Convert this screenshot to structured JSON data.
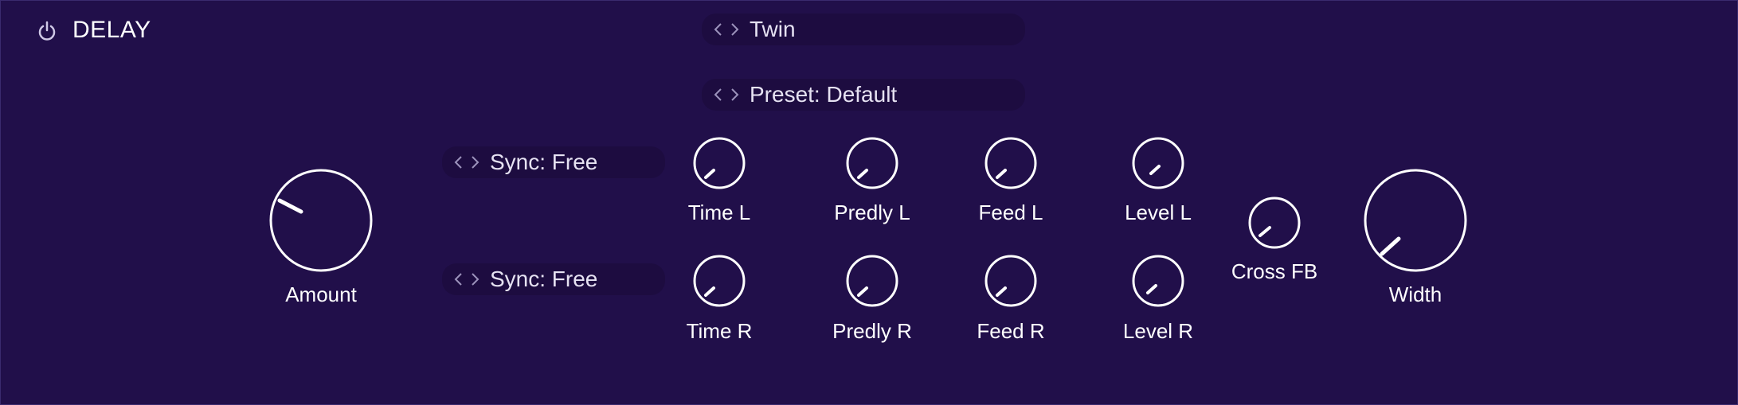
{
  "header": {
    "title": "DELAY",
    "power_icon": "power-icon"
  },
  "mode_selector": {
    "value": "Twin"
  },
  "preset_selector": {
    "value": "Preset: Default"
  },
  "sync_left": {
    "value": "Sync: Free"
  },
  "sync_right": {
    "value": "Sync: Free"
  },
  "knobs": {
    "amount": {
      "label": "Amount"
    },
    "time_l": {
      "label": "Time L"
    },
    "predly_l": {
      "label": "Predly L"
    },
    "feed_l": {
      "label": "Feed L"
    },
    "level_l": {
      "label": "Level L"
    },
    "time_r": {
      "label": "Time R"
    },
    "predly_r": {
      "label": "Predly R"
    },
    "feed_r": {
      "label": "Feed R"
    },
    "level_r": {
      "label": "Level R"
    },
    "cross_fb": {
      "label": "Cross FB"
    },
    "width": {
      "label": "Width"
    }
  },
  "colors": {
    "background": "#210f4a",
    "selector_bg": "#1d0c40",
    "knob_stroke": "#ffffff"
  }
}
